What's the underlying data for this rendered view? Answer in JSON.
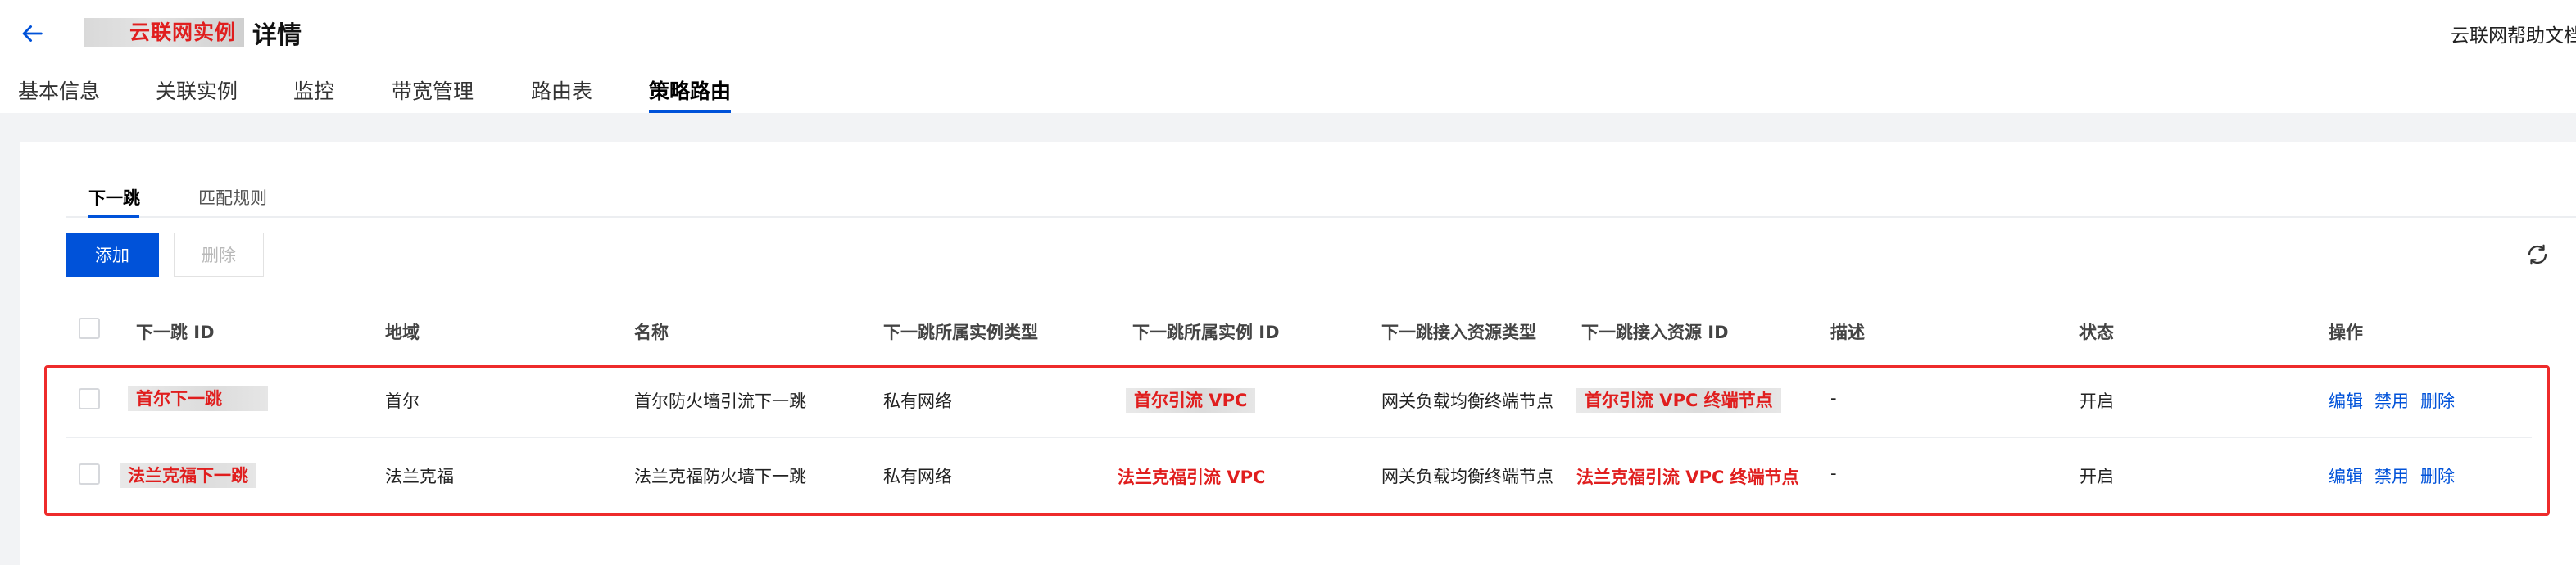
{
  "header": {
    "masked_name": "云联网实例",
    "title_suffix": "详情",
    "help_link": "云联网帮助文档"
  },
  "tabs": [
    "基本信息",
    "关联实例",
    "监控",
    "带宽管理",
    "路由表",
    "策略路由"
  ],
  "active_tab": "策略路由",
  "subtabs": [
    "下一跳",
    "匹配规则"
  ],
  "active_subtab": "下一跳",
  "toolbar": {
    "add_label": "添加",
    "delete_label": "删除"
  },
  "table": {
    "columns": [
      "下一跳 ID",
      "地域",
      "名称",
      "下一跳所属实例类型",
      "下一跳所属实例 ID",
      "下一跳接入资源类型",
      "下一跳接入资源 ID",
      "描述",
      "状态",
      "操作"
    ],
    "rows": [
      {
        "id": "首尔下一跳",
        "region": "首尔",
        "name": "首尔防火墙引流下一跳",
        "instance_type": "私有网络",
        "instance_id": "首尔引流 VPC",
        "resource_type": "网关负载均衡终端节点",
        "resource_id": "首尔引流 VPC 终端节点",
        "description": "-",
        "status": "开启",
        "ops": [
          "编辑",
          "禁用",
          "删除"
        ]
      },
      {
        "id": "法兰克福下一跳",
        "region": "法兰克福",
        "name": "法兰克福防火墙下一跳",
        "instance_type": "私有网络",
        "instance_id": "法兰克福引流 VPC",
        "resource_type": "网关负载均衡终端节点",
        "resource_id": "法兰克福引流 VPC 终端节点",
        "description": "-",
        "status": "开启",
        "ops": [
          "编辑",
          "禁用",
          "删除"
        ]
      }
    ]
  },
  "colors": {
    "accent": "#0052d9",
    "highlight_red": "#ee2b2b",
    "masked_text": "#e01e1e"
  }
}
